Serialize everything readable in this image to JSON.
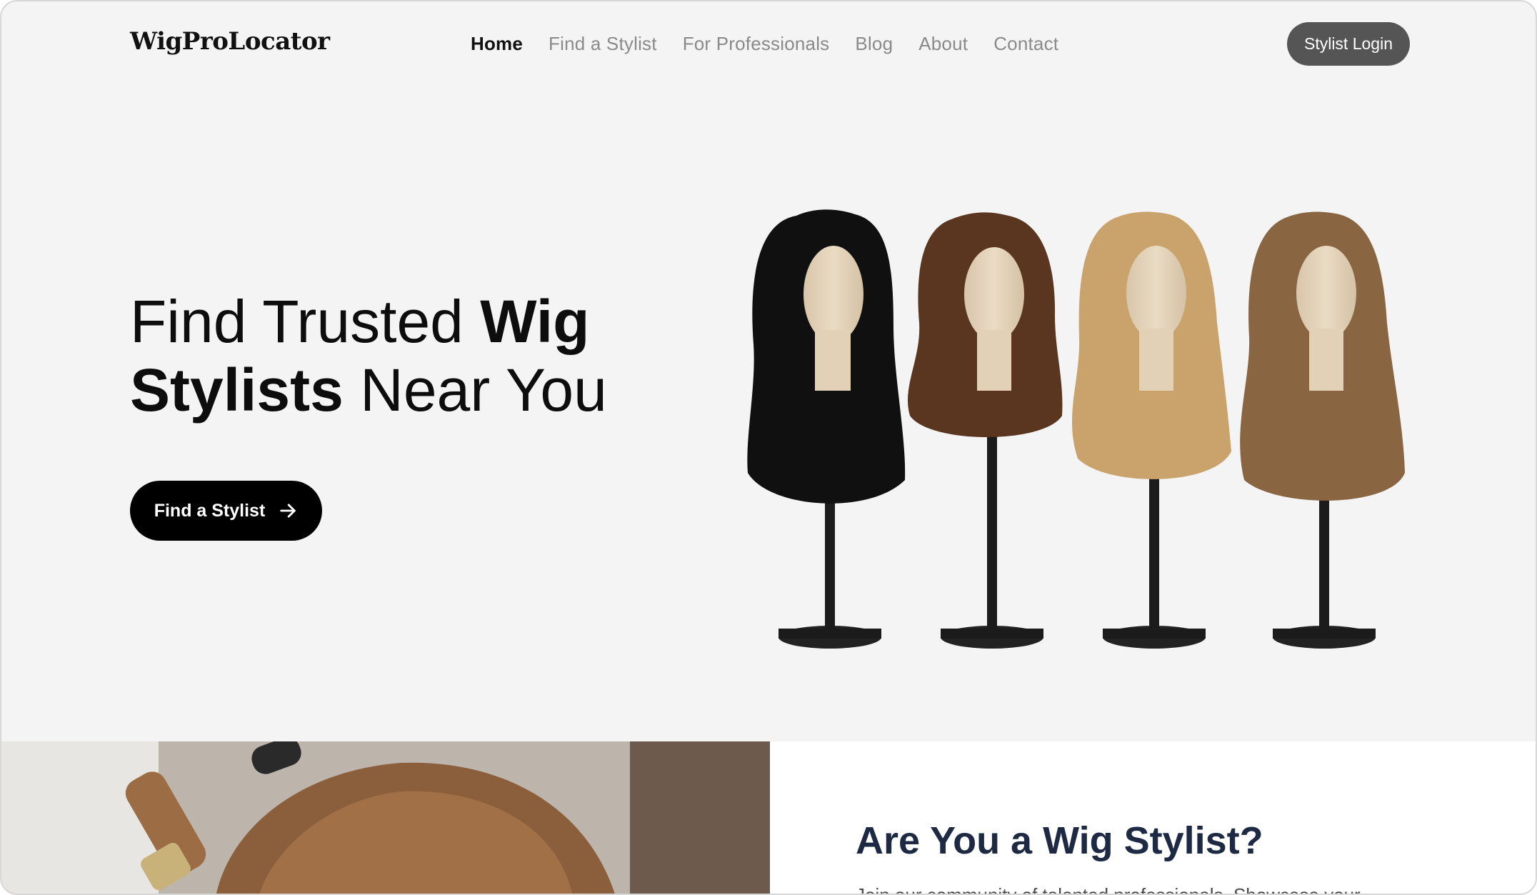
{
  "header": {
    "logo": "WigProLocator",
    "nav": [
      "Home",
      "Find a Stylist",
      "For Professionals",
      "Blog",
      "About",
      "Contact"
    ],
    "login_label": "Stylist Login"
  },
  "hero": {
    "title_part1": "Find Trusted ",
    "title_bold1": "Wig",
    "title_bold2": "Stylists",
    "title_part2": " Near You",
    "cta_label": "Find a Stylist",
    "cta_icon": "arrow-right-icon",
    "wig_colors": [
      "#111111",
      "#5a351f",
      "#c9a36b",
      "#8a6542"
    ]
  },
  "promo": {
    "title": "Are You a Wig Stylist?",
    "text": "Join our community of talented professionals. Showcase your"
  },
  "colors": {
    "page_bg": "#f4f4f4",
    "login_bg": "#555555",
    "cta_bg": "#000000",
    "promo_title": "#1e2a44"
  }
}
